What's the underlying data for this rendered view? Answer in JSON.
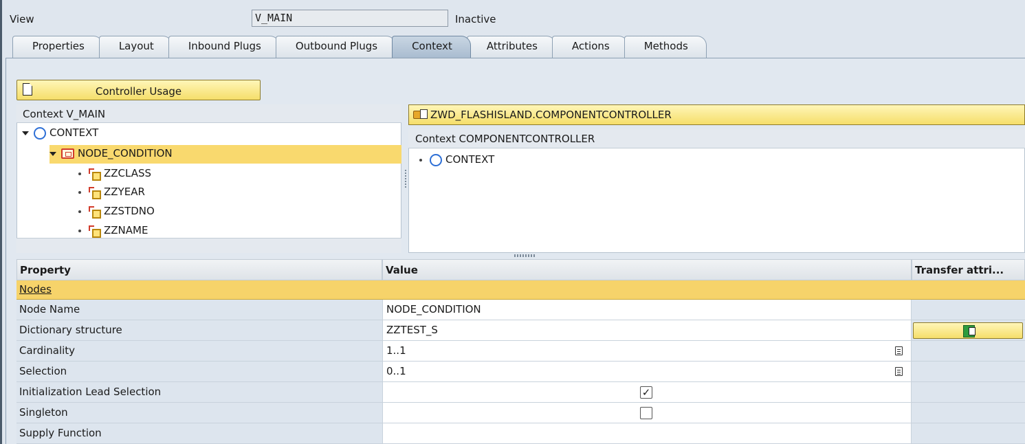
{
  "header": {
    "view_label": "View",
    "view_name": "V_MAIN",
    "status": "Inactive"
  },
  "tabs": [
    {
      "label": "Properties",
      "active": false
    },
    {
      "label": "Layout",
      "active": false
    },
    {
      "label": "Inbound Plugs",
      "active": false
    },
    {
      "label": "Outbound Plugs",
      "active": false
    },
    {
      "label": "Context",
      "active": true
    },
    {
      "label": "Attributes",
      "active": false
    },
    {
      "label": "Actions",
      "active": false
    },
    {
      "label": "Methods",
      "active": false
    }
  ],
  "toolbar": {
    "controller_usage_label": "Controller Usage"
  },
  "left_tree": {
    "title": "Context V_MAIN",
    "root": "CONTEXT",
    "node": "NODE_CONDITION",
    "attributes": [
      "ZZCLASS",
      "ZZYEAR",
      "ZZSTDNO",
      "ZZNAME"
    ]
  },
  "right_panel": {
    "controller": "ZWD_FLASHISLAND.COMPONENTCONTROLLER",
    "title": "Context COMPONENTCONTROLLER",
    "root": "CONTEXT"
  },
  "properties": {
    "col_property": "Property",
    "col_value": "Value",
    "col_transfer": "Transfer attri...",
    "group": "Nodes",
    "rows": [
      {
        "property": "Node Name",
        "value": "NODE_CONDITION"
      },
      {
        "property": "Dictionary structure",
        "value": "ZZTEST_S"
      },
      {
        "property": "Cardinality",
        "value": "1..1"
      },
      {
        "property": "Selection",
        "value": "0..1"
      },
      {
        "property": "Initialization Lead Selection",
        "value": "✓"
      },
      {
        "property": "Singleton",
        "value": ""
      },
      {
        "property": "Supply Function",
        "value": ""
      }
    ]
  },
  "colors": {
    "selection": "#f9d96e",
    "button_yellow": "#f5de6a",
    "panel_bg": "#e1e8f0"
  }
}
